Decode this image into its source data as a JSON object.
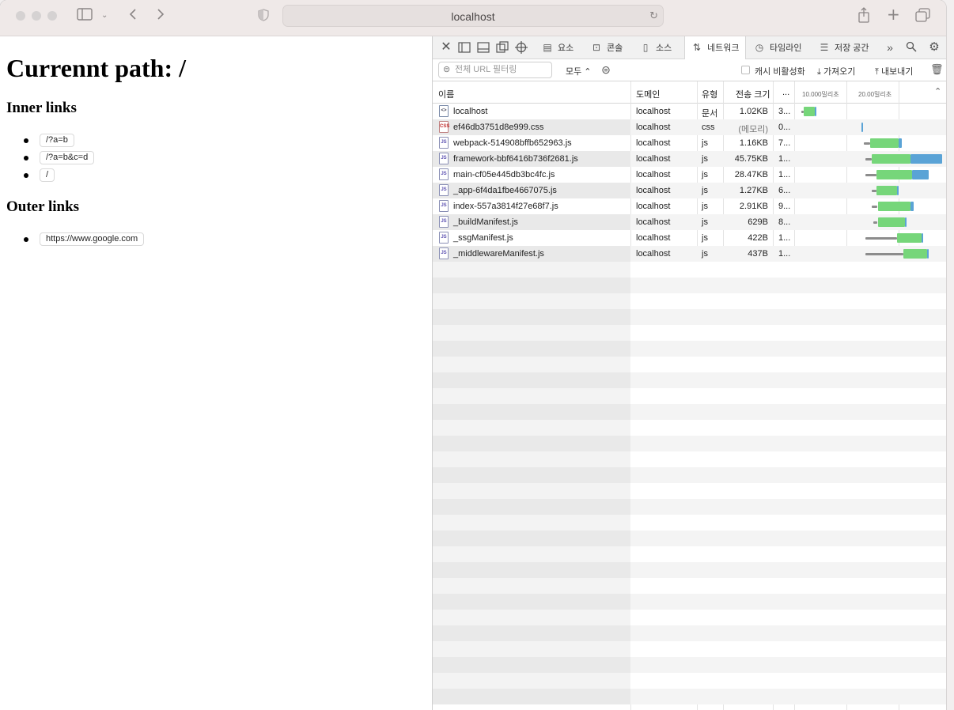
{
  "browser": {
    "address": "localhost"
  },
  "page": {
    "title": "Currennt path: /",
    "inner_heading": "Inner links",
    "inner_links": [
      "/?a=b",
      "/?a=b&c=d",
      "/"
    ],
    "outer_heading": "Outer links",
    "outer_links": [
      "https://www.google.com"
    ]
  },
  "devtools": {
    "tabs": [
      {
        "label": "요소",
        "icon": "elements-icon"
      },
      {
        "label": "콘솔",
        "icon": "console-icon"
      },
      {
        "label": "소스",
        "icon": "sources-icon"
      },
      {
        "label": "네트워크",
        "icon": "network-icon"
      },
      {
        "label": "타임라인",
        "icon": "timeline-icon"
      },
      {
        "label": "저장 공간",
        "icon": "storage-icon"
      }
    ],
    "filter_placeholder": "전체 URL 필터링",
    "type_filter": "모두",
    "disable_cache": "캐시 비활성화",
    "import_label": "가져오기",
    "export_label": "내보내기",
    "columns": {
      "name": "이름",
      "domain": "도메인",
      "type": "유형",
      "size": "전송 크기",
      "more": "...",
      "t1": "10.000밀리초",
      "t2": "20.00밀리초"
    },
    "requests": [
      {
        "name": "localhost",
        "domain": "localhost",
        "type": "문서",
        "size": "1.02KB",
        "time": "3...",
        "kind": "doc",
        "wait_start": 0.04,
        "wait_end": 0.06,
        "green_end": 0.13,
        "blue_end": 0.135
      },
      {
        "name": "ef46db3751d8e999.css",
        "domain": "localhost",
        "type": "css",
        "size": "(메모리)",
        "time": "0...",
        "kind": "css",
        "wait_start": 0.44,
        "wait_end": 0.44,
        "green_end": 0.44,
        "blue_end": 0.455
      },
      {
        "name": "webpack-514908bffb652963.js",
        "domain": "localhost",
        "type": "js",
        "size": "1.16KB",
        "time": "7...",
        "kind": "js",
        "wait_start": 0.46,
        "wait_end": 0.5,
        "green_end": 0.69,
        "blue_end": 0.71
      },
      {
        "name": "framework-bbf6416b736f2681.js",
        "domain": "localhost",
        "type": "js",
        "size": "45.75KB",
        "time": "1...",
        "kind": "js",
        "wait_start": 0.47,
        "wait_end": 0.51,
        "green_end": 0.77,
        "blue_end": 0.98
      },
      {
        "name": "main-cf05e445db3bc4fc.js",
        "domain": "localhost",
        "type": "js",
        "size": "28.47KB",
        "time": "1...",
        "kind": "js",
        "wait_start": 0.47,
        "wait_end": 0.54,
        "green_end": 0.78,
        "blue_end": 0.89
      },
      {
        "name": "_app-6f4da1fbe4667075.js",
        "domain": "localhost",
        "type": "js",
        "size": "1.27KB",
        "time": "6...",
        "kind": "js",
        "wait_start": 0.51,
        "wait_end": 0.54,
        "green_end": 0.68,
        "blue_end": 0.69
      },
      {
        "name": "index-557a3814f27e68f7.js",
        "domain": "localhost",
        "type": "js",
        "size": "2.91KB",
        "time": "9...",
        "kind": "js",
        "wait_start": 0.51,
        "wait_end": 0.55,
        "green_end": 0.77,
        "blue_end": 0.79
      },
      {
        "name": "_buildManifest.js",
        "domain": "localhost",
        "type": "js",
        "size": "629B",
        "time": "8...",
        "kind": "js",
        "wait_start": 0.52,
        "wait_end": 0.55,
        "green_end": 0.73,
        "blue_end": 0.74
      },
      {
        "name": "_ssgManifest.js",
        "domain": "localhost",
        "type": "js",
        "size": "422B",
        "time": "1...",
        "kind": "js",
        "wait_start": 0.47,
        "wait_end": 0.68,
        "green_end": 0.84,
        "blue_end": 0.85
      },
      {
        "name": "_middlewareManifest.js",
        "domain": "localhost",
        "type": "js",
        "size": "437B",
        "time": "1...",
        "kind": "js",
        "wait_start": 0.47,
        "wait_end": 0.72,
        "green_end": 0.88,
        "blue_end": 0.89
      }
    ]
  },
  "colors": {
    "waterfall_wait": "#8c8c8c",
    "waterfall_receive": "#76d67a",
    "waterfall_download": "#5aa3d6"
  }
}
